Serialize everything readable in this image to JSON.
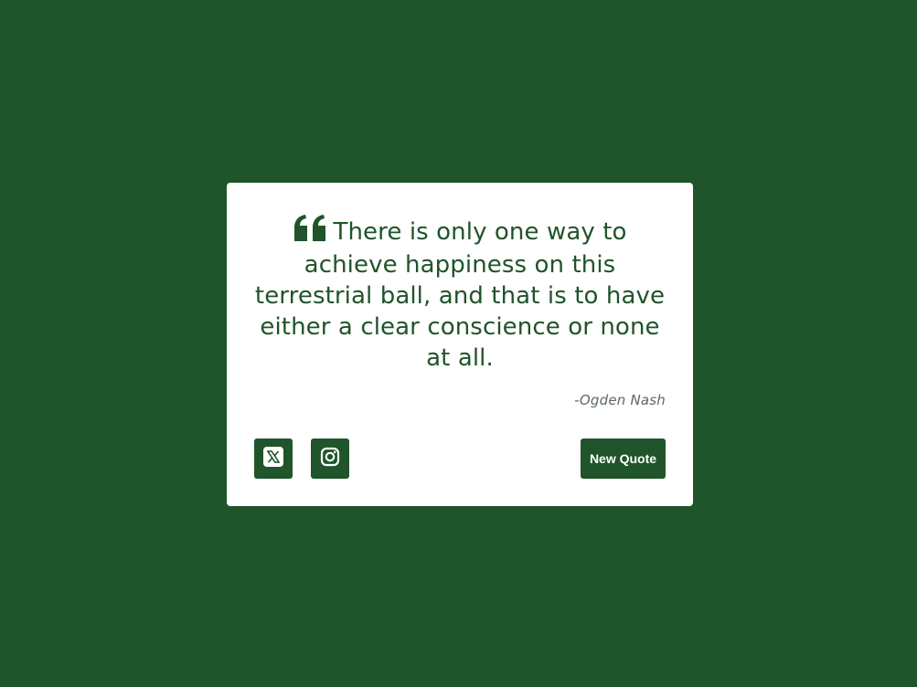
{
  "theme": {
    "accent": "#20542a",
    "card_bg": "#ffffff",
    "author_color": "#5b6a5f"
  },
  "quote": {
    "mark_icon": "quote-left-icon",
    "text": "There is only one way to achieve happiness on this terrestrial ball, and that is to have either a clear conscience or none at all.",
    "author": "-Ogden Nash"
  },
  "actions": {
    "twitter_icon": "x-twitter-icon",
    "instagram_icon": "instagram-icon",
    "new_quote_label": "New Quote"
  }
}
